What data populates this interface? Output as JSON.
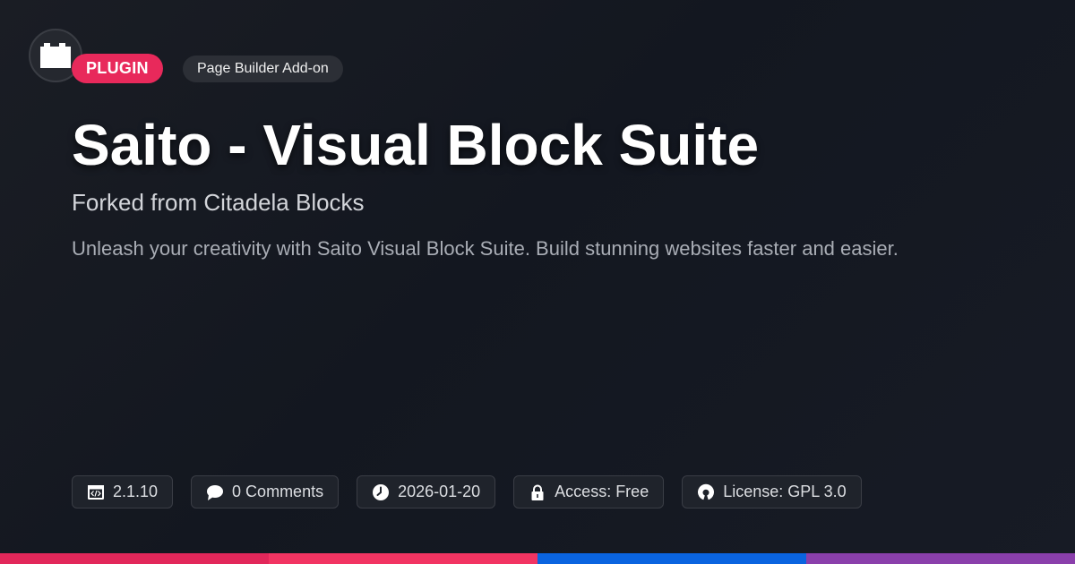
{
  "badges": {
    "type": "PLUGIN",
    "category": "Page Builder Add-on"
  },
  "title": "Saito - Visual Block Suite",
  "subtitle": "Forked from Citadela Blocks",
  "description": "Unleash your creativity with Saito Visual Block Suite. Build stunning websites faster and easier.",
  "meta": {
    "version": {
      "icon": "code-window-icon",
      "text": "2.1.10"
    },
    "comments": {
      "icon": "chat-bubble-icon",
      "text": "0 Comments"
    },
    "date": {
      "icon": "clock-icon",
      "text": "2026-01-20"
    },
    "access": {
      "icon": "lock-icon",
      "text": "Access: Free"
    },
    "license": {
      "icon": "open-source-icon",
      "text": "License: GPL 3.0"
    }
  },
  "colors": {
    "accent": "#e8295b",
    "bar": [
      "#e2275a",
      "#f23462",
      "#0a64e0",
      "#8a3fab"
    ]
  }
}
